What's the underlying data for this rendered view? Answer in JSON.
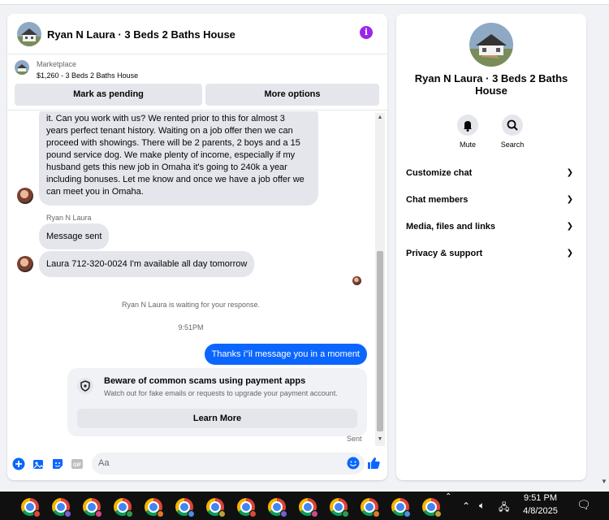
{
  "chat": {
    "title": "Ryan N Laura · 3 Beds 2 Baths House",
    "marketplace": {
      "label": "Marketplace",
      "listing": "$1,260 - 3 Beds 2 Baths House",
      "mark_pending": "Mark as pending",
      "more_options": "More options"
    },
    "messages": {
      "long_message_lines": [
        "it.  Can you work with us?  We rented prior to this for almost 3",
        "years perfect tenant history.  Waiting on a job offer then we can",
        "proceed with showings.  There will be 2 parents, 2 boys and a 15",
        "pound service dog.  We make plenty of income, especially if my",
        "husband gets this new job in Omaha it's going to 240k a year",
        "including bonuses.  Let me know and once we have a job offer we",
        "can meet you in Omaha."
      ],
      "sender_name": "Ryan N Laura",
      "msg_sent": "Message sent",
      "msg_phone": "Laura 712-320-0024 I'm available all day tomorrow",
      "waiting": "Ryan N Laura is waiting for your response.",
      "time": "9:51PM",
      "outgoing": "Thanks i\"il message you in a moment",
      "sent_status": "Sent"
    },
    "scam_notice": {
      "title": "Beware of common scams using payment apps",
      "subtitle": "Watch out for fake emails or requests to upgrade your payment account.",
      "button": "Learn More"
    },
    "composer": {
      "placeholder": "Aa",
      "gif_label": "GIF"
    }
  },
  "info_panel": {
    "name": "Ryan N Laura · 3 Beds 2 Baths House",
    "actions": [
      {
        "label": "Mute",
        "icon": "bell-icon"
      },
      {
        "label": "Search",
        "icon": "search-icon"
      }
    ],
    "sections": [
      {
        "label": "Customize chat"
      },
      {
        "label": "Chat members"
      },
      {
        "label": "Media, files and links"
      },
      {
        "label": "Privacy & support"
      }
    ],
    "chevron": "⌄"
  },
  "taskbar": {
    "time": "9:51 PM",
    "date": "4/8/2025",
    "app_count": 14
  },
  "colors": {
    "accent": "#0a66ff",
    "info_icon": "#9b27e8",
    "bubble_in": "#e4e6eb"
  }
}
